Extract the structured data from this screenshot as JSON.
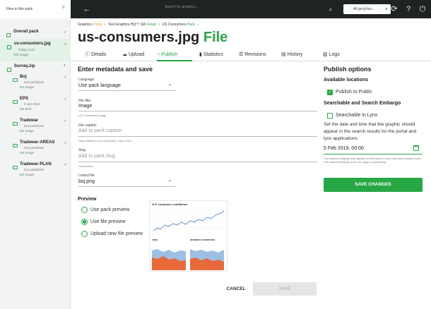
{
  "sidebar": {
    "title": "Files in this pack",
    "overall_pack": "Overall pack",
    "items": [
      {
        "name": "us-consumers.jpg",
        "meta1": "Today, 9:43",
        "meta2": "Image"
      },
      {
        "name": "Survey.zip"
      },
      {
        "name": "Boj",
        "status": "Not published",
        "meta2": "Image"
      },
      {
        "name": "EPS",
        "meta1": "9 Jan 2019",
        "meta2": "EPS"
      },
      {
        "name": "Tradewar",
        "status": "Not published",
        "meta2": "Image"
      },
      {
        "name": "Tradewar-AREAS",
        "status": "Not published",
        "meta2": "Image"
      },
      {
        "name": "Tradewar-PLAN",
        "status": "Not published",
        "meta2": "Image"
      }
    ],
    "lang": "EN"
  },
  "topbar": {
    "search_placeholder": "Search for graphics...",
    "filter": "All graphics..."
  },
  "breadcrumb": {
    "portal_pre": "Graphics",
    "portal": "Portal",
    "group_pre": "Test Graphics HQ™ QA",
    "group": "Group",
    "pack_pre": "US Consumers",
    "pack": "Pack"
  },
  "title": {
    "name": "us-consumers.jpg",
    "type": "File"
  },
  "tabs": [
    "Details",
    "Upload",
    "Publish",
    "Statistics",
    "Revisions",
    "History",
    "Logs"
  ],
  "metadata": {
    "heading": "Enter metadata and save",
    "language_label": "Language",
    "language_value": "Use pack language",
    "file_title_label": "File title",
    "file_title_value": "Image",
    "file_title_help": "US Consumers Image",
    "caption_label": "File caption",
    "caption_placeholder": "Add to pack caption",
    "caption_help": "Data related to US consumers, since 2012",
    "slug_label": "Slug",
    "slug_placeholder": "Add to pack slug",
    "slug_help": "Consumers",
    "linked_label": "Linked file",
    "linked_value": "boj.png"
  },
  "preview": {
    "heading": "Preview",
    "options": [
      "Use pack preview",
      "Use file preview",
      "Upload new file preview"
    ],
    "selected": 1
  },
  "thumb": {
    "title": "U.S. consumer confidence",
    "sub_left": "JOBS",
    "sub_right": "BUSINESS CONDITIONS"
  },
  "publish": {
    "heading": "Publish options",
    "locations_label": "Available locations",
    "public_label": "Publish to Public",
    "embargo_heading": "Searchable and Search Embargo",
    "lynx_label": "Searchable in Lynx",
    "embargo_text": "Set the date and time that the graphic should appear in the search results for the portal and lynx applications",
    "date_value": "5 Feb 2019, 00:00",
    "embargo_help": "The search embargo date applies to this found in Lynx and other search tools. The search embargo does not apply to publishing.",
    "save_changes": "SAVE CHANGES"
  },
  "footer": {
    "cancel": "CANCEL",
    "save": "SAVE"
  },
  "colors": {
    "accent": "#28a745",
    "dark": "#1f2322",
    "orange": "#f0a030"
  }
}
